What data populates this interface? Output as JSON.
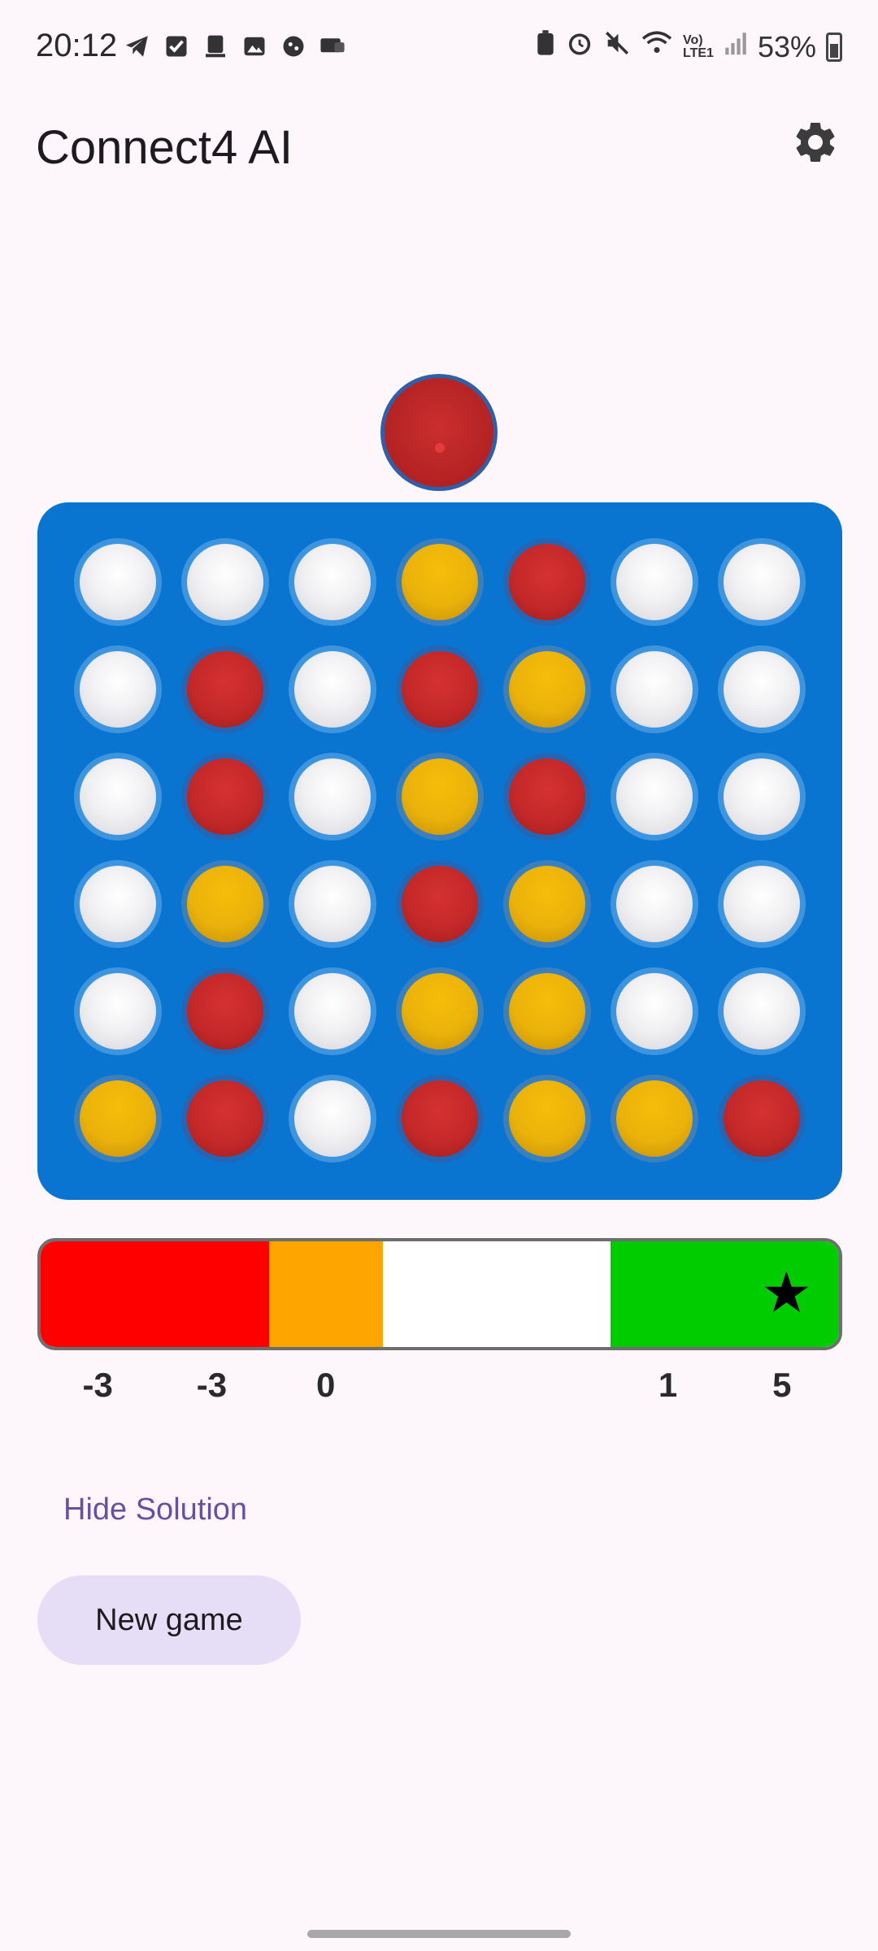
{
  "status_bar": {
    "time": "20:12",
    "battery": "53%",
    "left_icons": [
      "telegram-icon",
      "check-icon",
      "notification-icon",
      "image-icon",
      "game-icon",
      "message-icon"
    ],
    "right_icons": [
      "battery-saver-icon",
      "alarm-icon",
      "mute-icon",
      "wifi-icon",
      "volte-icon",
      "signal-icon"
    ]
  },
  "app_bar": {
    "title": "Connect4 AI",
    "settings_icon": "gear-icon"
  },
  "preview_disc": {
    "color": "red"
  },
  "board": {
    "rows": 6,
    "cols": 7,
    "grid": [
      [
        "empty",
        "empty",
        "empty",
        "yellow",
        "red",
        "empty",
        "empty"
      ],
      [
        "empty",
        "red",
        "empty",
        "red",
        "yellow",
        "empty",
        "empty"
      ],
      [
        "empty",
        "red",
        "empty",
        "yellow",
        "red",
        "empty",
        "empty"
      ],
      [
        "empty",
        "yellow",
        "empty",
        "red",
        "yellow",
        "empty",
        "empty"
      ],
      [
        "empty",
        "red",
        "empty",
        "yellow",
        "yellow",
        "empty",
        "empty"
      ],
      [
        "yellow",
        "red",
        "empty",
        "red",
        "yellow",
        "yellow",
        "red"
      ]
    ],
    "colors": {
      "board": "#0a75d1",
      "red": "#c42828",
      "yellow": "#eab20a"
    }
  },
  "evaluation": {
    "segments": [
      {
        "color": "#ff0000",
        "from": 0,
        "to": 2
      },
      {
        "color": "#ffa500",
        "from": 2,
        "to": 3
      },
      {
        "color": "#ffffff",
        "from": 3,
        "to": 5
      },
      {
        "color": "#00cc00",
        "from": 5,
        "to": 7
      }
    ],
    "scores": [
      "-3",
      "-3",
      "0",
      "",
      "",
      "1",
      "5"
    ],
    "best_icon": "star-icon"
  },
  "actions": {
    "hide_solution": "Hide Solution",
    "new_game": "New game"
  }
}
